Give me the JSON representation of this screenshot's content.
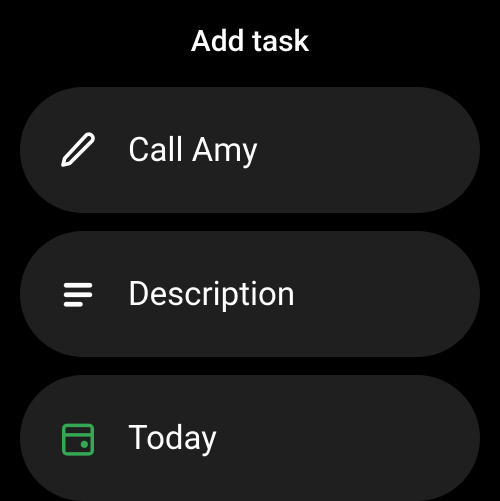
{
  "header": {
    "title": "Add task"
  },
  "rows": {
    "taskName": {
      "label": "Call Amy"
    },
    "description": {
      "label": "Description"
    },
    "date": {
      "label": "Today"
    }
  },
  "colors": {
    "accent": "#34a853"
  }
}
